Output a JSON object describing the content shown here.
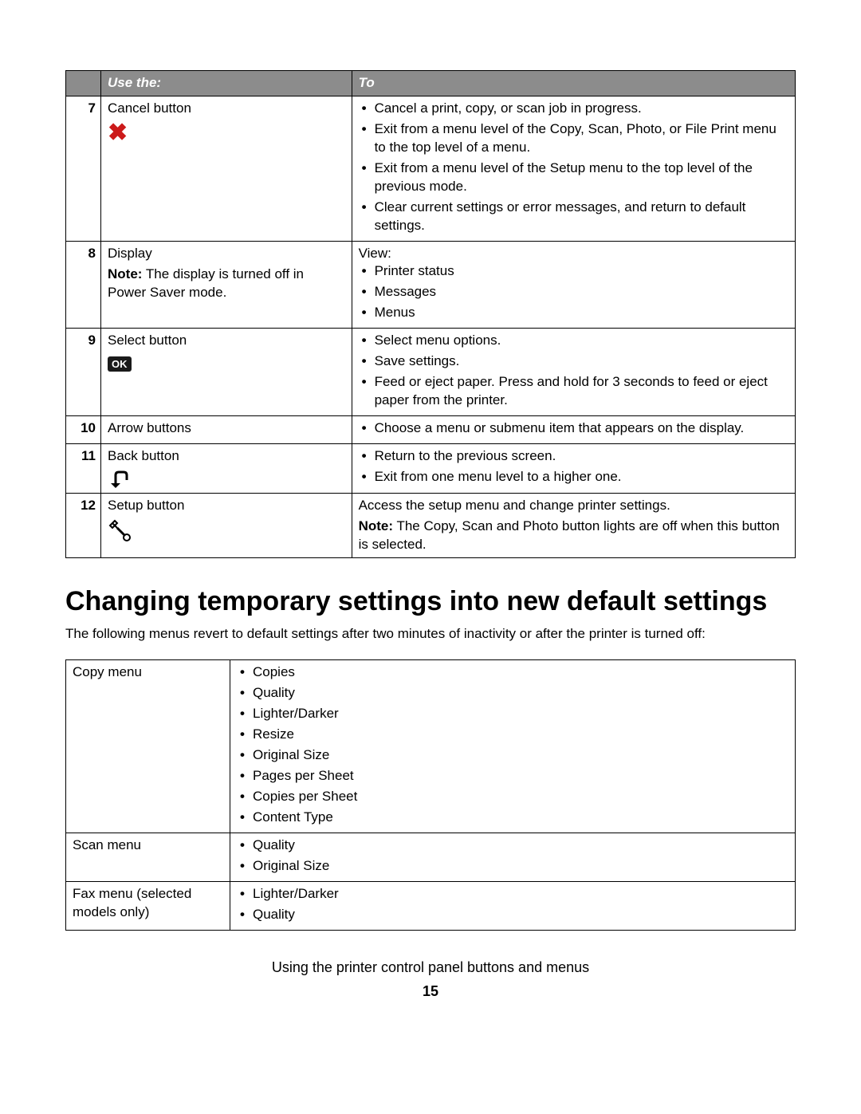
{
  "table1": {
    "headers": {
      "col1": "Use the:",
      "col2": "To"
    },
    "rows": [
      {
        "num": "7",
        "label": "Cancel button",
        "iconName": "cancel-icon",
        "actions": [
          "Cancel a print, copy, or scan job in progress.",
          "Exit from a menu level of the Copy, Scan, Photo, or File Print menu to the top level of a menu.",
          "Exit from a menu level of the Setup menu to the top level of the previous mode.",
          "Clear current settings or error messages, and return to default settings."
        ]
      },
      {
        "num": "8",
        "label": "Display",
        "noteLabel": "Note:",
        "noteText": " The display is turned off in Power Saver mode.",
        "viewLabel": "View:",
        "actions": [
          "Printer status",
          "Messages",
          "Menus"
        ]
      },
      {
        "num": "9",
        "label": "Select button",
        "iconName": "ok-icon",
        "iconText": "OK",
        "actions": [
          "Select menu options.",
          "Save settings.",
          "Feed or eject paper. Press and hold for 3 seconds to feed or eject paper from the printer."
        ]
      },
      {
        "num": "10",
        "label": "Arrow buttons",
        "actions": [
          "Choose a menu or submenu item that appears on the display."
        ]
      },
      {
        "num": "11",
        "label": "Back button",
        "iconName": "back-icon",
        "actions": [
          "Return to the previous screen.",
          "Exit from one menu level to a higher one."
        ]
      },
      {
        "num": "12",
        "label": "Setup button",
        "iconName": "setup-icon",
        "descText": "Access the setup menu and change printer settings.",
        "noteLabel2": "Note:",
        "noteText2": " The Copy, Scan and Photo button lights are off when this button is selected."
      }
    ]
  },
  "heading": "Changing temporary settings into new default settings",
  "introText": "The following menus revert to default settings after two minutes of inactivity or after the printer is turned off:",
  "table2": {
    "rows": [
      {
        "label": "Copy menu",
        "items": [
          "Copies",
          "Quality",
          "Lighter/Darker",
          "Resize",
          "Original Size",
          "Pages per Sheet",
          "Copies per Sheet",
          "Content Type"
        ]
      },
      {
        "label": "Scan menu",
        "items": [
          "Quality",
          "Original Size"
        ]
      },
      {
        "label": "Fax menu (selected models only)",
        "items": [
          "Lighter/Darker",
          "Quality"
        ]
      }
    ]
  },
  "footerTitle": "Using the printer control panel buttons and menus",
  "pageNumber": "15"
}
